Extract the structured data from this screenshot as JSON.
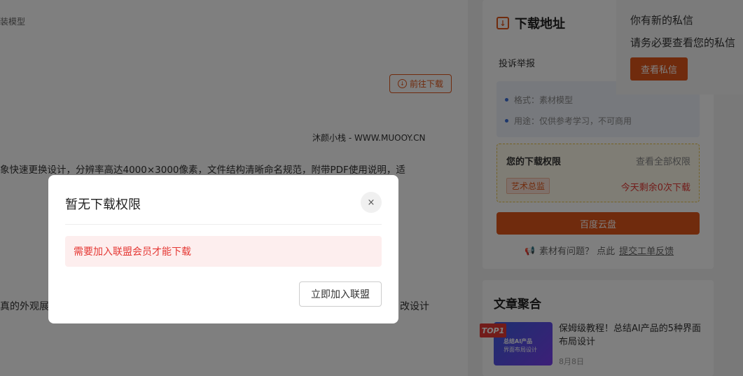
{
  "main": {
    "breadcrumb": "装模型",
    "goto_download": "前往下载",
    "watermark": "沐颜小栈 - WWW.MUOOY.CN",
    "desc_line1": "象快速更换设计，分辨率高达4000×3000像素，文件结构清晰命名规范，附带PDF使用说明，适",
    "desc_line2_left": "真的外观展",
    "desc_line2_right": "改设计"
  },
  "sidebar": {
    "title": "下载地址",
    "report": "投诉举报",
    "info": [
      "格式：素材模型",
      "用途：仅供参考学习，不可商用"
    ],
    "permission": {
      "title": "您的下载权限",
      "view_all": "查看全部权限",
      "tag": "艺术总监",
      "remaining": "今天剩余0次下载"
    },
    "cloud_button": "百度云盘",
    "feedback_prefix": "素材有问题？ 点此",
    "feedback_link": "提交工单反馈"
  },
  "articles": {
    "title": "文章聚合",
    "top_badge": "TOP1",
    "thumb_line1": "总结AI产品",
    "thumb_line2": "界面布局设计",
    "item_title": "保姆级教程！总结AI产品的5种界面布局设计",
    "item_date": "8月8日"
  },
  "message": {
    "line1": "你有新的私信",
    "line2": "请务必要查看您的私信",
    "button": "查看私信"
  },
  "modal": {
    "title": "暂无下载权限",
    "close": "×",
    "alert": "需要加入联盟会员才能下载",
    "join_button": "立即加入联盟"
  },
  "colors": {
    "accent": "#e0561b",
    "alert_red": "#e53935"
  }
}
